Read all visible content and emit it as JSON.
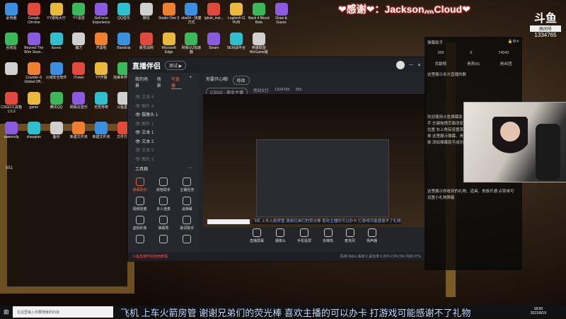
{
  "desktop": {
    "icons": [
      [
        "此电脑",
        "Google Chrome",
        "YY游戏大厅",
        "YY语音",
        "GeForce Experience",
        "QQ音乐",
        "微信",
        "Studio One 3",
        "obs64 - 快捷方式",
        "lghub_inst...",
        "Logitech G HUB",
        "Back 4 Blood Beta",
        "Draw & Guess"
      ],
      [
        "回收站",
        "Beyond The Wire Soun...",
        "itunes",
        "魔方",
        "开黑啦",
        "Bandizip",
        "暴雪战网",
        "Microsoft Edge",
        "网易UU加速器",
        "Steam",
        "5E对战平台",
        "英雄联盟 WeGame版"
      ],
      [
        "",
        "Counter-S Global Off...",
        "火绒安全软件",
        "iTunes",
        "YY开播",
        "完美世界平台"
      ],
      [
        "CSGO工具箱 1.0.3",
        "game",
        "腾讯QQ",
        "网易云音乐",
        "无忧传奇",
        "斗鱼直播"
      ],
      [
        "sweencfg",
        "zhaopian",
        "备份",
        "新建文件夹",
        "新建文件夹",
        "文件万能"
      ]
    ],
    "stray_label": "551"
  },
  "overlay": {
    "thanks": "❤感谢❤：Jackson灬Cloud❤",
    "douyu_brand": "斗鱼",
    "room_label": "房间号",
    "room_id": "1334765"
  },
  "app": {
    "title": "直播伴侣",
    "badge": "测试 ▶",
    "tabs": [
      "我的场景",
      "场景",
      "可直播"
    ],
    "layers": [
      {
        "name": "文本 4",
        "visible": false
      },
      {
        "name": "图片 4",
        "visible": false
      },
      {
        "name": "摄像头 1",
        "visible": true
      },
      {
        "name": "图片 1",
        "visible": false
      },
      {
        "name": "文本 1",
        "visible": true
      },
      {
        "name": "文本 2",
        "visible": true
      },
      {
        "name": "文本 3",
        "visible": false
      },
      {
        "name": "图片 2",
        "visible": false
      }
    ],
    "toolbox_title": "工具箱",
    "tools": [
      "弹幕助手",
      "房管助手",
      "主播任务",
      "视频连麦",
      "多人连麦",
      "谈弹幕",
      "虚拟形象",
      "弹幕秀",
      "歌词助手",
      "",
      "",
      ""
    ],
    "stream_title": "你要开心哦!",
    "edit": "修改",
    "category": "CSGO - 美女主播",
    "live_status": "房间文打",
    "room_id": "1334765",
    "heat": "356",
    "controls": [
      "直播屏幕",
      "摄像头",
      "手机投屏",
      "多媒体",
      "麦克风",
      "扬声器"
    ],
    "status_left": "斗鱼直播伴侣使用教程",
    "status_right": "码率:0kb/s   丢帧:0   丢包率:0.00%   CPU:6%   内存:27%",
    "preview_danmu": "飞机 上车火箭房管 谢谢兄弟们的荧光棒 喜欢主播的可以办卡 打游戏可能感谢不了礼物"
  },
  "panel": {
    "title": "弹幕助手",
    "stats": [
      "356",
      "6",
      "74042"
    ],
    "tabs": [
      "贡献榜",
      "贵宾(6)",
      "粉丝团"
    ],
    "msg1": "这里展示本次直播的数",
    "msg2": "欢迎使用斗鱼弹幕助手 左键拖拽页面改变位置 右上角有设置菜单 这里展示弹幕、贵族 添加弹幕助手成功",
    "msg3": "这里展示你收到的礼物、道具、贵族开通 点菜单可设置小礼物屏蔽"
  },
  "taskbar": {
    "search_placeholder": "在这里输入你要搜索的内容",
    "time": "18:50",
    "date": "2021/8/19"
  },
  "danmu": "飞机 上车火箭房管 谢谢兄弟们的荧光棒 喜欢主播的可以办卡 打游戏可能感谢不了礼物",
  "colors": {
    "accent": "#f06a35"
  }
}
